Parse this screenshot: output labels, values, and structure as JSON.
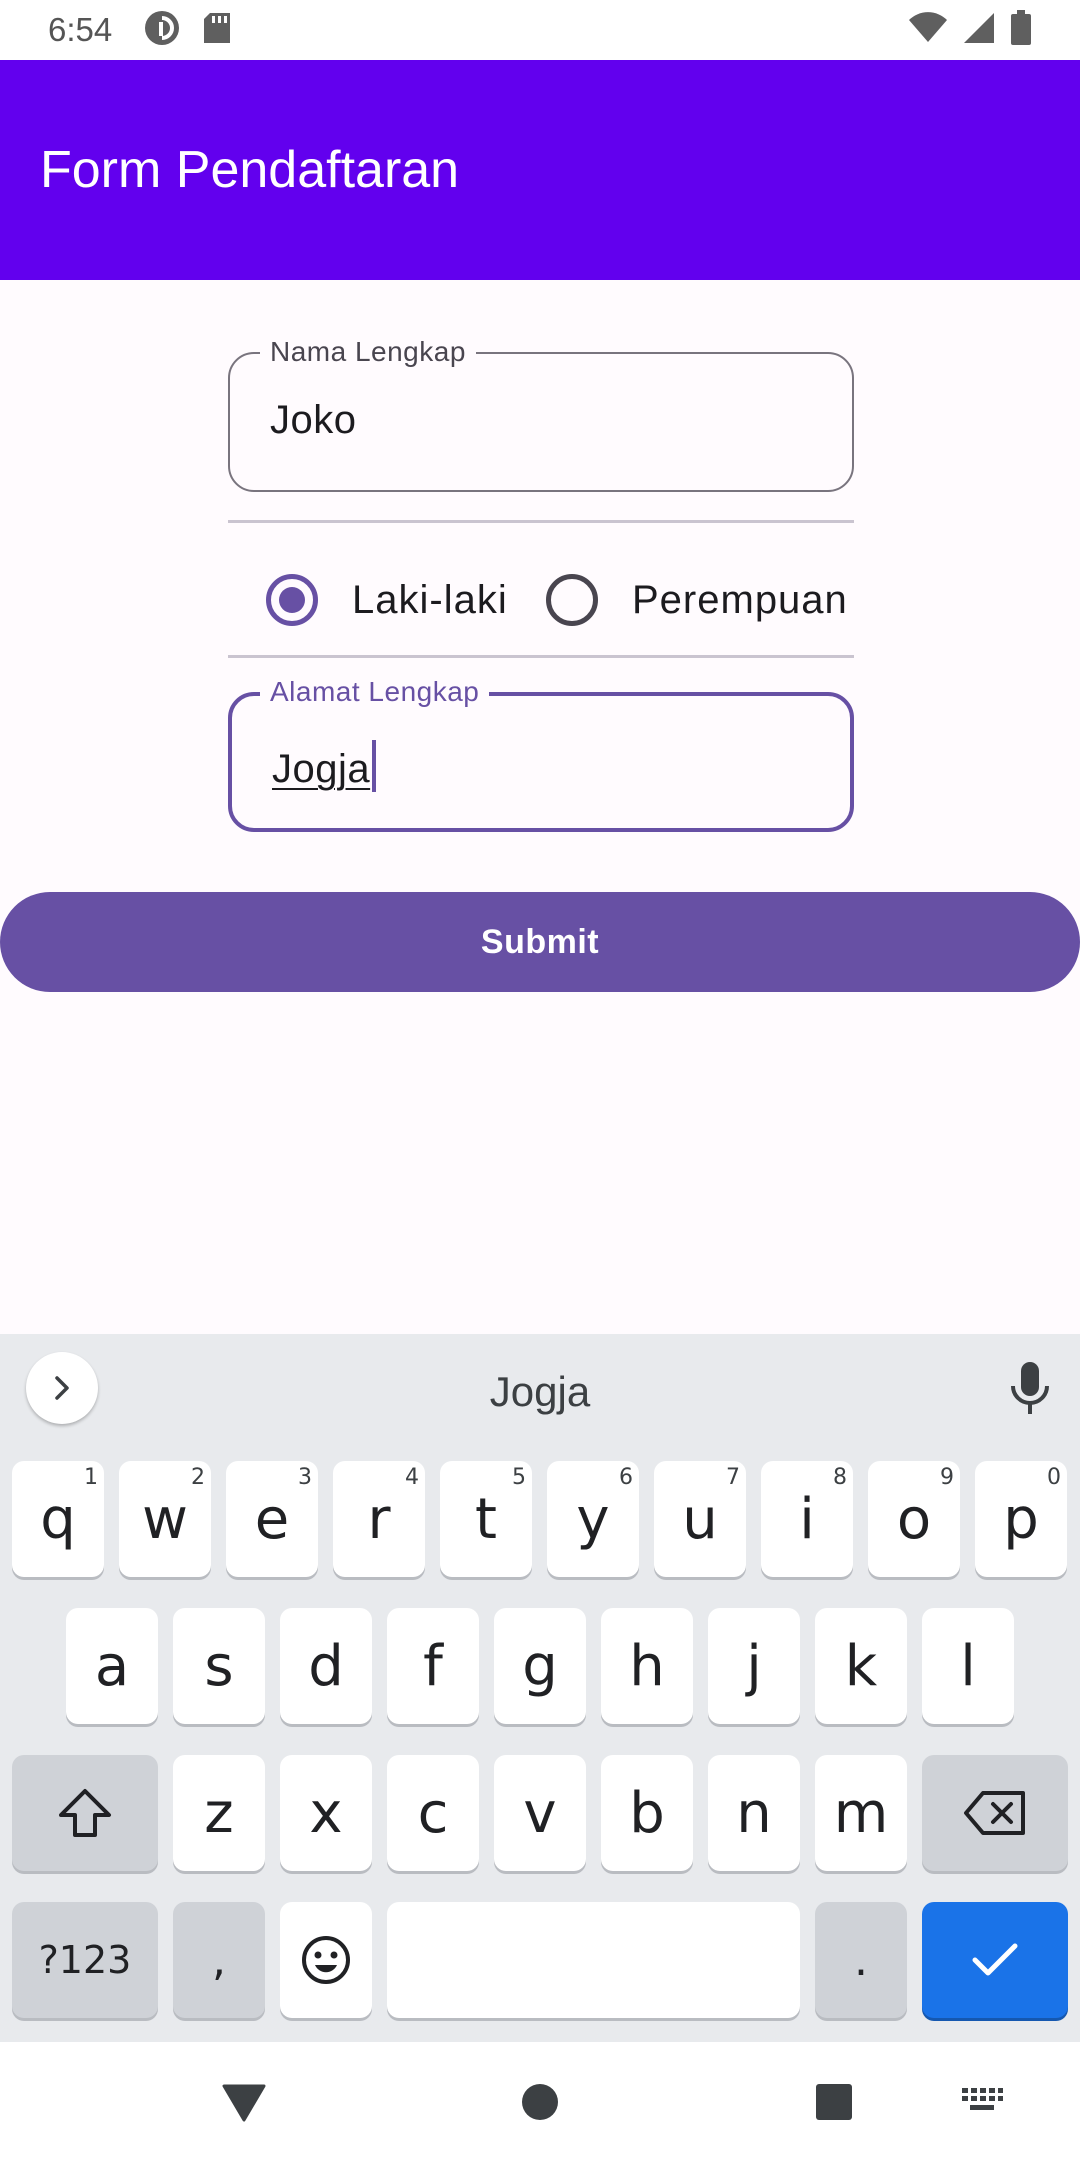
{
  "status_bar": {
    "time": "6:54",
    "icons_left": [
      "pocket-casts-icon",
      "sd-card-icon"
    ],
    "icons_right": [
      "wifi-icon",
      "cell-signal-icon",
      "battery-icon"
    ]
  },
  "app_bar": {
    "title": "Form Pendaftaran",
    "color": "#6200ee"
  },
  "form": {
    "name_field": {
      "label": "Nama Lengkap",
      "value": "Joko"
    },
    "gender": {
      "options": [
        {
          "label": "Laki-laki",
          "selected": true
        },
        {
          "label": "Perempuan",
          "selected": false
        }
      ]
    },
    "address_field": {
      "label": "Alamat Lengkap",
      "value": "Jogja",
      "focused": true
    },
    "submit_label": "Submit",
    "accent_color": "#6750a4"
  },
  "keyboard": {
    "suggestion": "Jogja",
    "row1": [
      {
        "key": "q",
        "hint": "1"
      },
      {
        "key": "w",
        "hint": "2"
      },
      {
        "key": "e",
        "hint": "3"
      },
      {
        "key": "r",
        "hint": "4"
      },
      {
        "key": "t",
        "hint": "5"
      },
      {
        "key": "y",
        "hint": "6"
      },
      {
        "key": "u",
        "hint": "7"
      },
      {
        "key": "i",
        "hint": "8"
      },
      {
        "key": "o",
        "hint": "9"
      },
      {
        "key": "p",
        "hint": "0"
      }
    ],
    "row2": [
      "a",
      "s",
      "d",
      "f",
      "g",
      "h",
      "j",
      "k",
      "l"
    ],
    "row3": [
      "z",
      "x",
      "c",
      "v",
      "b",
      "n",
      "m"
    ],
    "symbols_label": "?123",
    "comma": ",",
    "period": ".",
    "enter_color": "#1a73e8"
  },
  "nav_bar": {
    "items": [
      "back-icon",
      "home-icon",
      "recents-icon",
      "keyboard-switch-icon"
    ]
  }
}
